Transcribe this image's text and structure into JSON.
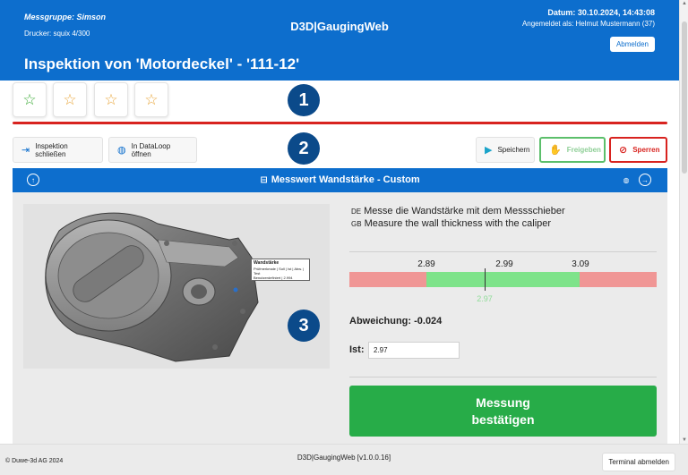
{
  "header": {
    "group": "Messgruppe: Simson",
    "printer": "Drucker: squix 4/300",
    "brand": "D3D|GaugingWeb",
    "date": "Datum: 30.10.2024, 14:43:08",
    "user": "Angemeldet als: Helmut Mustermann (37)",
    "logout_label": "Abmelden",
    "title": "Inspektion von 'Motordeckel' - '111-12'",
    "color": "#0d6ecd"
  },
  "stars": [
    {
      "icon": "star-outline-icon",
      "color": "#3aaa35"
    },
    {
      "icon": "star-outline-icon",
      "color": "#e8a53a"
    },
    {
      "icon": "star-outline-icon",
      "color": "#e8a53a"
    },
    {
      "icon": "star-outline-icon",
      "color": "#e8a53a"
    }
  ],
  "badges": [
    "1",
    "2",
    "3"
  ],
  "toolbar": {
    "close_label": "Inspektion schließen",
    "dataloop_label": "In DataLoop öffnen",
    "save_label": "Speichern",
    "release_label": "Freigeben",
    "lock_label": "Sperren"
  },
  "panel": {
    "title": "Messwert Wandstärke - Custom"
  },
  "tooltip": {
    "title": "Wandstärke",
    "row1": "Prüfmerkmale | Soll | Ist | Abw. | Test",
    "row2": "Benutzerdefiniert | 2.994"
  },
  "instructions": {
    "de_code": "DE",
    "de_text": "Messe die Wandstärke mit dem Messschieber",
    "gb_code": "GB",
    "gb_text": "Measure the wall thickness with the caliper"
  },
  "scale": {
    "lower": "2.89",
    "nominal": "2.99",
    "upper": "3.09",
    "measured": "2.97"
  },
  "deviation": "Abweichung: -0.024",
  "ist_label": "Ist:",
  "ist_value": "2.97",
  "confirm_label": "Messung bestätigen",
  "footer": {
    "copyright": "© Duwe-3d AG 2024",
    "version": "D3D|GaugingWeb [v1.0.0.16]",
    "terminal_logout": "Terminal abmelden"
  },
  "colors": {
    "brand_blue": "#0d6ecd",
    "badge_navy": "#0b4a8a",
    "ok_green": "#27ac48",
    "tolerance_green": "#7ee38a",
    "out_of_tolerance_red": "#f09695",
    "lock_red": "#d8231f"
  }
}
